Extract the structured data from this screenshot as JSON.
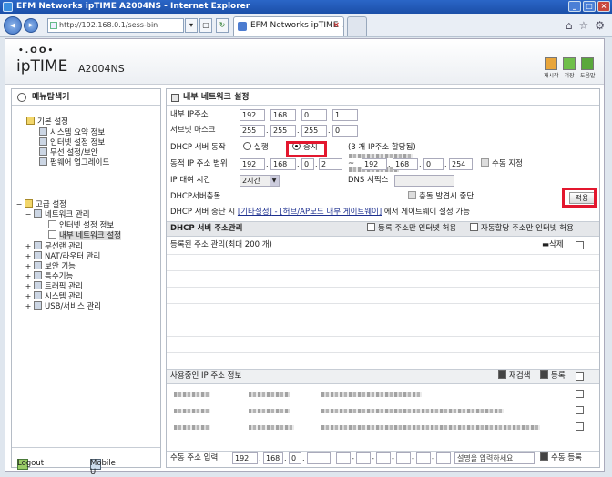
{
  "window": {
    "title": "EFM Networks ipTIME A2004NS - Internet Explorer"
  },
  "browser": {
    "address": "http://192.168.0.1/sess-bin",
    "tab_label": "EFM Networks ipTIME ..."
  },
  "header": {
    "logo_dots": "•.OO•",
    "logo_brand": "ipTIME",
    "model": "A2004NS",
    "icons": [
      {
        "name": "restart-icon",
        "label": "재시작",
        "color": "#e8a53a"
      },
      {
        "name": "save-icon",
        "label": "저장",
        "color": "#6fbf4a"
      },
      {
        "name": "help-icon",
        "label": "도움말",
        "color": "#5aa83c"
      }
    ]
  },
  "sidebar": {
    "title": "메뉴탐색기",
    "basic": {
      "label": "기본 설정",
      "items": [
        "시스템 요약 정보",
        "인터넷 설정 정보",
        "무선 설정/보안",
        "펌웨어 업그레이드"
      ]
    },
    "advanced": {
      "label": "고급 설정",
      "network": "네트워크 관리",
      "network_items": [
        "인터넷 설정 정보",
        "내부 네트워크 설정"
      ],
      "others": [
        "무선랜 관리",
        "NAT/라우터 관리",
        "보안 기능",
        "특수기능",
        "트래픽 관리",
        "시스템 관리",
        "USB/서비스 관리"
      ]
    },
    "footer": {
      "logout": "Logout",
      "mobile": "Mobile UI"
    }
  },
  "main": {
    "title": "내부 네트워크 설정",
    "internal_ip": {
      "label": "내부 IP주소",
      "values": [
        "192",
        "168",
        "0",
        "1"
      ]
    },
    "subnet": {
      "label": "서브넷 마스크",
      "values": [
        "255",
        "255",
        "255",
        "0"
      ]
    },
    "dhcp": {
      "label": "DHCP 서버 동작",
      "run": "실행",
      "stop": "중지",
      "note": "(3 개 IP주소 할당됨)",
      "selected": "stop"
    },
    "dynamic_range": {
      "label": "동적 IP 주소 범위",
      "start": [
        "192",
        "168",
        "0",
        "2"
      ],
      "sep": "~",
      "end": [
        "192",
        "168",
        "0",
        "254"
      ],
      "manual": "수동 지정"
    },
    "lease": {
      "label": "IP 대여 시간",
      "value": "2시간",
      "dns_label": "DNS 서픽스"
    },
    "conflict": {
      "label": "DHCP서버충돌",
      "stop_on_detect": "충돌 발견시 중단",
      "apply": "적용"
    },
    "notice": {
      "prefix": "DHCP 서버 중단 시",
      "link1": "[기타설정]",
      "dash": " - ",
      "link2": "[허브/AP모드 내부 게이트웨이]",
      "suffix": "에서 게이트웨이 설정 가능"
    },
    "address_mgmt": {
      "title": "DHCP 서버 주소관리",
      "opt1": "등록 주소만 인터넷 허용",
      "opt2": "자동할당 주소만 인터넷 허용"
    },
    "registered": {
      "label": "등록된 주소 관리(최대 200 개)",
      "delete": "삭제"
    },
    "in_use": {
      "label": "사용중인 IP 주소 정보",
      "rescan": "재검색",
      "register": "등록"
    },
    "manual_entry": {
      "label": "수동 주소 입력",
      "ip": [
        "192",
        "168",
        "0",
        ""
      ],
      "desc_placeholder": "설명을 입력하세요",
      "register": "수동 등록"
    }
  },
  "colors": {
    "highlight": "#e3172e",
    "titlebar": "#1b4fa8"
  }
}
